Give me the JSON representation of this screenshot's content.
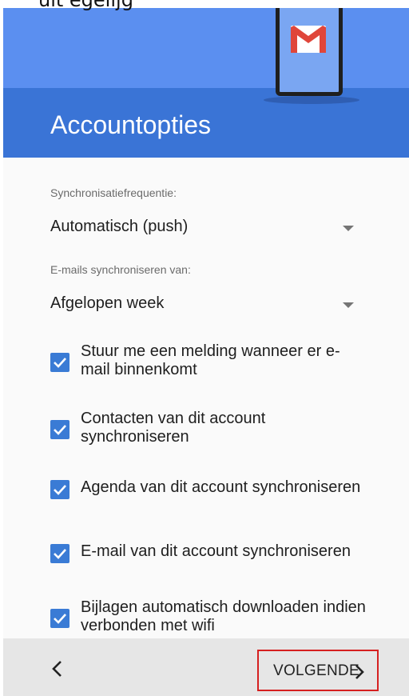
{
  "header": {
    "top_caption": "uit egelijg",
    "title": "Accountopties",
    "illustration_icon": "gmail-logo-icon"
  },
  "sync_frequency": {
    "label": "Synchronisatiefrequentie:",
    "value": "Automatisch (push)"
  },
  "sync_range": {
    "label": "E-mails synchroniseren van:",
    "value": "Afgelopen week"
  },
  "options": [
    {
      "label": "Stuur me een melding wanneer er e-mail binnenkomt",
      "checked": true
    },
    {
      "label": "Contacten van dit account synchroniseren",
      "checked": true
    },
    {
      "label": "Agenda van dit account synchroniseren",
      "checked": true
    },
    {
      "label": "E-mail van dit account synchroniseren",
      "checked": true
    },
    {
      "label": "Bijlagen automatisch downloaden indien verbonden met wifi",
      "checked": true
    }
  ],
  "footer": {
    "back_icon": "chevron-left-icon",
    "next_label": "VOLGENDE",
    "next_icon": "chevron-right-icon",
    "highlight_color": "#d62020"
  },
  "colors": {
    "accent": "#3a7bd5",
    "header_light": "#5b8ff0",
    "header_dark": "#3a74d6"
  }
}
